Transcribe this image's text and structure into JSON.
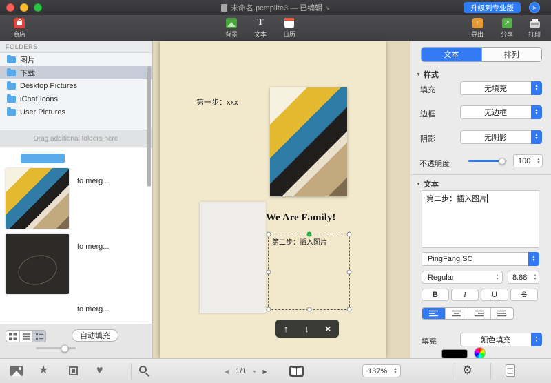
{
  "titlebar": {
    "title": "未命名.pcmplite3 — 已编辑",
    "title_chevron": "∨",
    "upgrade_label": "升级到专业版"
  },
  "toolbar": {
    "store": "商店",
    "background": "背景",
    "text": "文本",
    "calendar": "日历",
    "export": "导出",
    "share": "分享",
    "print": "打印"
  },
  "sidebar": {
    "folders_header": "FOLDERS",
    "folders": [
      {
        "label": "图片",
        "selected": false
      },
      {
        "label": "下载",
        "selected": true
      },
      {
        "label": "Desktop Pictures",
        "selected": false
      },
      {
        "label": "iChat Icons",
        "selected": false
      },
      {
        "label": "User Pictures",
        "selected": false
      }
    ],
    "drag_hint": "Drag additional folders here",
    "thumbnails": [
      {
        "label": "to merg..."
      },
      {
        "label": "to merg..."
      },
      {
        "label": "to merg..."
      }
    ],
    "autofill_label": "自动填充"
  },
  "canvas": {
    "step1_text": "第一步：xxx",
    "family_text": "We Are Family!",
    "step2_text": "第二步：插入图片"
  },
  "inspector": {
    "tabs": [
      {
        "label": "文本",
        "selected": true
      },
      {
        "label": "排列",
        "selected": false
      }
    ],
    "style_section": "样式",
    "fill_label": "填充",
    "fill_value": "无填充",
    "border_label": "边框",
    "border_value": "无边框",
    "shadow_label": "阴影",
    "shadow_value": "无阴影",
    "opacity_label": "不透明度",
    "opacity_value": "100",
    "text_section": "文本",
    "text_value": "第二步：插入图片",
    "font_value": "PingFang SC",
    "weight_value": "Regular",
    "size_value": "8.88",
    "format": {
      "bold": "B",
      "italic": "I",
      "underline": "U",
      "strike": "S"
    },
    "text_fill_label": "填充",
    "text_fill_value": "颜色填充"
  },
  "bottombar": {
    "page_indicator": "1/1",
    "zoom_value": "137%"
  },
  "icons": {
    "cap_up": "▲",
    "cap_down": "▼",
    "section_triangle": "▼",
    "prev": "◀",
    "next": "▶",
    "page_chevron": "▾",
    "up": "↑",
    "down": "↓",
    "close": "×",
    "send": "➤",
    "gear": "⚙",
    "star": "★",
    "heart": "♥",
    "share_arrow": "↗",
    "text_tool": "T"
  },
  "colors": {
    "accent_blue": "#2d7bf4",
    "canvas_cream": "#f2e9cc",
    "text_fill_swatch": "#000000"
  }
}
